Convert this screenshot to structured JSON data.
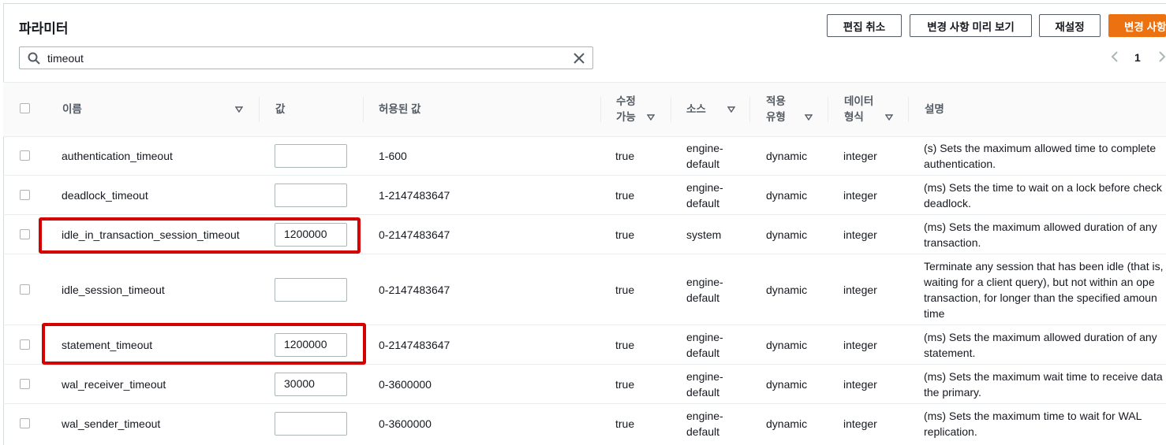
{
  "header": {
    "title": "파라미터",
    "buttons": {
      "cancel_edit": "편집 취소",
      "preview_changes": "변경 사항 미리 보기",
      "reset": "재설정",
      "save_changes": "변경 사항"
    }
  },
  "search": {
    "value": "timeout"
  },
  "pagination": {
    "current_page": "1"
  },
  "colors": {
    "accent": "#ec7211",
    "highlight": "#d50000"
  },
  "table": {
    "columns": {
      "name": "이름",
      "value": "값",
      "allowed": "허용된 값",
      "modifiable_1": "수정",
      "modifiable_2": "가능",
      "source": "소스",
      "apply_1": "적용",
      "apply_2": "유형",
      "dtype_1": "데이터",
      "dtype_2": "형식",
      "description": "설명"
    },
    "rows": [
      {
        "name": "authentication_timeout",
        "value": "",
        "allowed": "1-600",
        "modifiable": "true",
        "source_1": "engine-",
        "source_2": "default",
        "apply": "dynamic",
        "dtype": "integer",
        "desc_1": "(s) Sets the maximum allowed time to complete",
        "desc_2": "authentication."
      },
      {
        "name": "deadlock_timeout",
        "value": "",
        "allowed": "1-2147483647",
        "modifiable": "true",
        "source_1": "engine-",
        "source_2": "default",
        "apply": "dynamic",
        "dtype": "integer",
        "desc_1": "(ms) Sets the time to wait on a lock before check",
        "desc_2": "deadlock."
      },
      {
        "name": "idle_in_transaction_session_timeout",
        "value": "1200000",
        "allowed": "0-2147483647",
        "modifiable": "true",
        "source_1": "system",
        "source_2": "",
        "apply": "dynamic",
        "dtype": "integer",
        "desc_1": "(ms) Sets the maximum allowed duration of any",
        "desc_2": "transaction."
      },
      {
        "name": "idle_session_timeout",
        "value": "",
        "allowed": "0-2147483647",
        "modifiable": "true",
        "source_1": "engine-",
        "source_2": "default",
        "apply": "dynamic",
        "dtype": "integer",
        "desc_1": "Terminate any session that has been idle (that is,",
        "desc_2": "waiting for a client query), but not within an ope",
        "desc_3": "transaction, for longer than the specified amoun",
        "desc_4": "time"
      },
      {
        "name": "statement_timeout",
        "value": "1200000",
        "allowed": "0-2147483647",
        "modifiable": "true",
        "source_1": "engine-",
        "source_2": "default",
        "apply": "dynamic",
        "dtype": "integer",
        "desc_1": "(ms) Sets the maximum allowed duration of any",
        "desc_2": "statement."
      },
      {
        "name": "wal_receiver_timeout",
        "value": "30000",
        "allowed": "0-3600000",
        "modifiable": "true",
        "source_1": "engine-",
        "source_2": "default",
        "apply": "dynamic",
        "dtype": "integer",
        "desc_1": "(ms) Sets the maximum wait time to receive data",
        "desc_2": "the primary."
      },
      {
        "name": "wal_sender_timeout",
        "value": "",
        "allowed": "0-3600000",
        "modifiable": "true",
        "source_1": "engine-",
        "source_2": "default",
        "apply": "dynamic",
        "dtype": "integer",
        "desc_1": "(ms) Sets the maximum time to wait for WAL",
        "desc_2": "replication."
      }
    ]
  }
}
